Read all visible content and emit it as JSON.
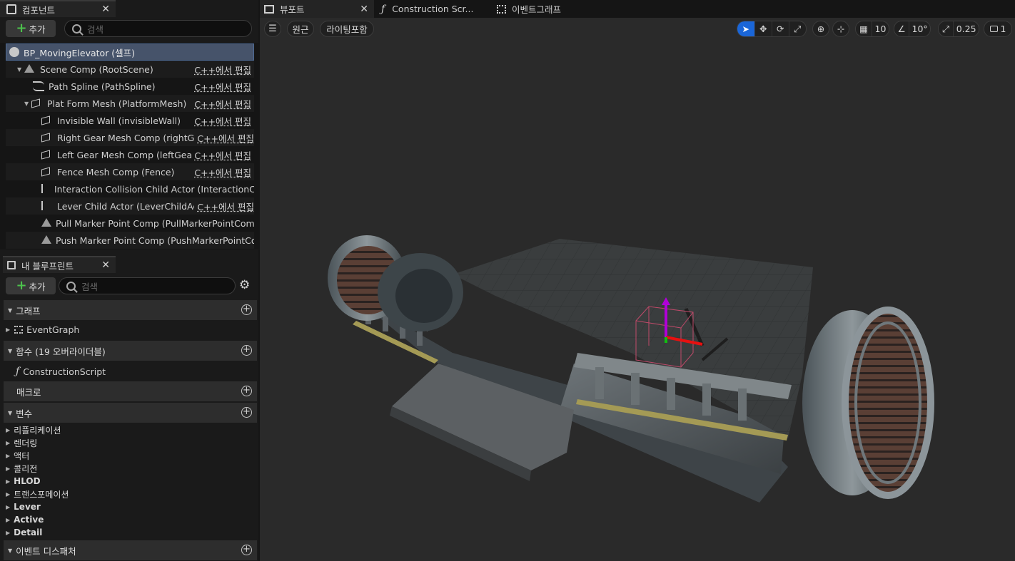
{
  "components_panel": {
    "tab_label": "컴포넌트",
    "add_label": "추가",
    "search_placeholder": "검색",
    "rows": [
      {
        "label": "BP_MovingElevator (셀프)",
        "edit": ""
      },
      {
        "label": "Scene Comp (RootScene)",
        "edit": "C++에서 편집"
      },
      {
        "label": "Path Spline (PathSpline)",
        "edit": "C++에서 편집"
      },
      {
        "label": "Plat Form Mesh (PlatformMesh)",
        "edit": "C++에서 편집"
      },
      {
        "label": "Invisible Wall (invisibleWall)",
        "edit": "C++에서 편집"
      },
      {
        "label": "Right Gear Mesh Comp (rightGear)",
        "edit": "C++에서 편집"
      },
      {
        "label": "Left Gear Mesh Comp (leftGear)",
        "edit": "C++에서 편집"
      },
      {
        "label": "Fence Mesh Comp (Fence)",
        "edit": "C++에서 편집"
      },
      {
        "label": "Interaction Collision Child Actor (InteractionChild",
        "edit": ""
      },
      {
        "label": "Lever Child Actor (LeverChildActor)",
        "edit": "C++에서 편집"
      },
      {
        "label": "Pull Marker Point Comp (PullMarkerPointComp)",
        "edit": ""
      },
      {
        "label": "Push Marker Point Comp (PushMarkerPointCom",
        "edit": ""
      }
    ]
  },
  "blueprint_panel": {
    "tab_label": "내 블루프린트",
    "add_label": "추가",
    "search_placeholder": "검색",
    "sections": {
      "graph": "그래프",
      "functions": "함수 (19 오버라이더블)",
      "macros": "매크로",
      "variables": "변수",
      "dispatchers": "이벤트 디스패처"
    },
    "graph_item": "EventGraph",
    "function_item": "ConstructionScript",
    "variables": [
      "리플리케이션",
      "렌더링",
      "액터",
      "콜리전",
      "HLOD",
      "트랜스포메이션",
      "Lever",
      "Active",
      "Detail"
    ]
  },
  "editor_tabs": [
    "뷰포트",
    "Construction Scr...",
    "이벤트그래프"
  ],
  "viewport_toolbar": {
    "perspective": "원근",
    "lighting": "라이팅포함",
    "grid_snap": "10",
    "rotation_snap": "10°",
    "scale_snap": "0.25",
    "camera_speed": "1"
  },
  "colors": {
    "selected_row": "#46536a",
    "active_tool": "#1a66d8",
    "add_plus": "#4cc24c"
  }
}
